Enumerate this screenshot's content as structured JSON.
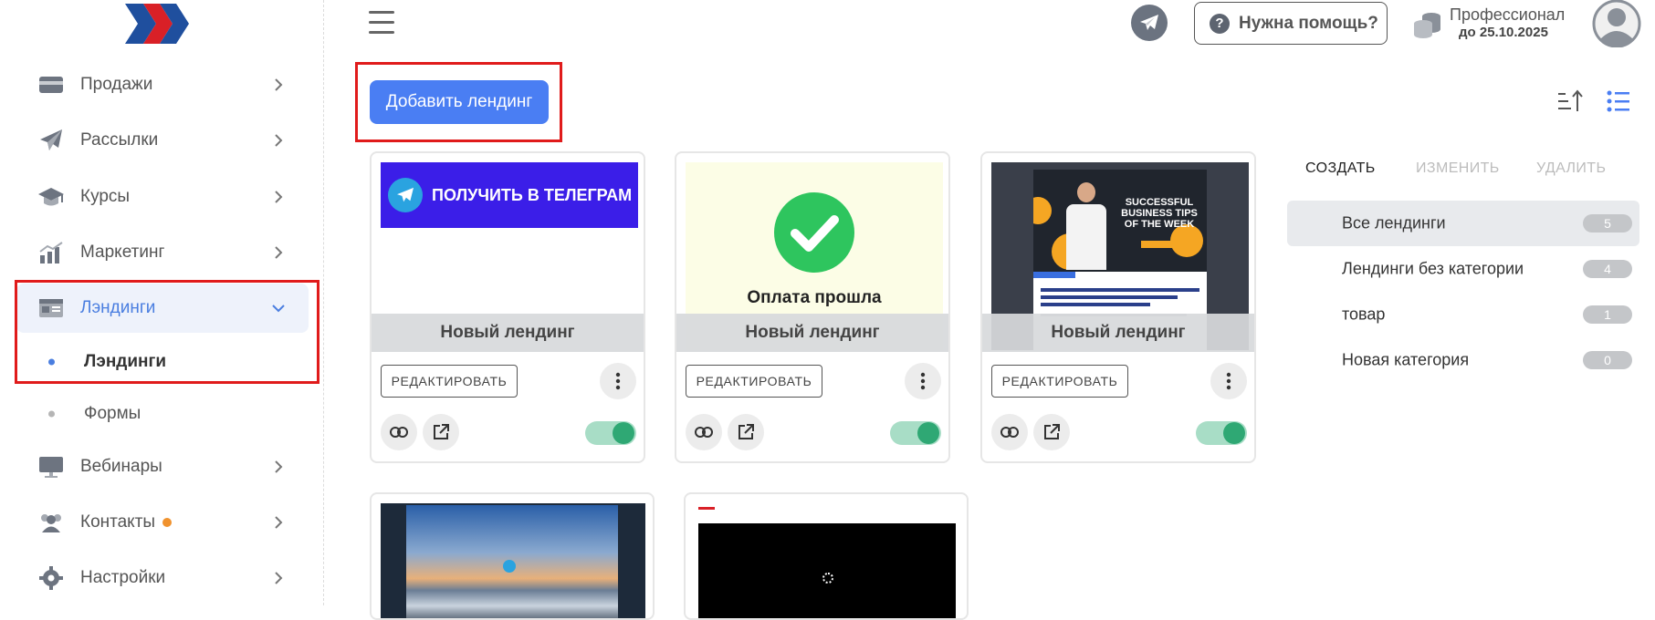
{
  "sidebar": {
    "items": [
      {
        "label": "Продажи",
        "icon": "wallet-icon"
      },
      {
        "label": "Рассылки",
        "icon": "paper-plane-icon"
      },
      {
        "label": "Курсы",
        "icon": "graduation-cap-icon"
      },
      {
        "label": "Маркетинг",
        "icon": "growth-chart-icon"
      },
      {
        "label": "Лэндинги",
        "icon": "landing-card-icon"
      },
      {
        "label": "Вебинары",
        "icon": "monitor-icon"
      },
      {
        "label": "Контакты",
        "icon": "users-icon"
      },
      {
        "label": "Настройки",
        "icon": "gear-icon"
      }
    ],
    "subitems": [
      {
        "label": "Лэндинги"
      },
      {
        "label": "Формы"
      }
    ]
  },
  "header": {
    "help_label": "Нужна помощь?",
    "plan_name": "Профессионал",
    "plan_until": "до 25.10.2025"
  },
  "toolbar": {
    "add_label": "Добавить лендинг"
  },
  "cards": [
    {
      "title": "Новый лендинг",
      "edit_label": "РЕДАКТИРОВАТЬ",
      "thumb_text": "ПОЛУЧИТЬ В ТЕЛЕГРАМ",
      "enabled": true
    },
    {
      "title": "Новый лендинг",
      "edit_label": "РЕДАКТИРОВАТЬ",
      "thumb_text": "Оплата прошла",
      "enabled": true
    },
    {
      "title": "Новый лендинг",
      "edit_label": "РЕДАКТИРОВАТЬ",
      "thumb_text": "SUCCESSFUL BUSINESS TIPS OF THE WEEK",
      "enabled": true
    }
  ],
  "categories": {
    "tabs": [
      "СОЗДАТЬ",
      "ИЗМЕНИТЬ",
      "УДАЛИТЬ"
    ],
    "items": [
      {
        "name": "Все лендинги",
        "count": "5"
      },
      {
        "name": "Лендинги без категории",
        "count": "4"
      },
      {
        "name": "товар",
        "count": "1"
      },
      {
        "name": "Новая категория",
        "count": "0"
      }
    ]
  },
  "colors": {
    "accent": "#4a7ef3",
    "highlight_box": "#e01b1b",
    "toggle_on": "#2fa874"
  }
}
